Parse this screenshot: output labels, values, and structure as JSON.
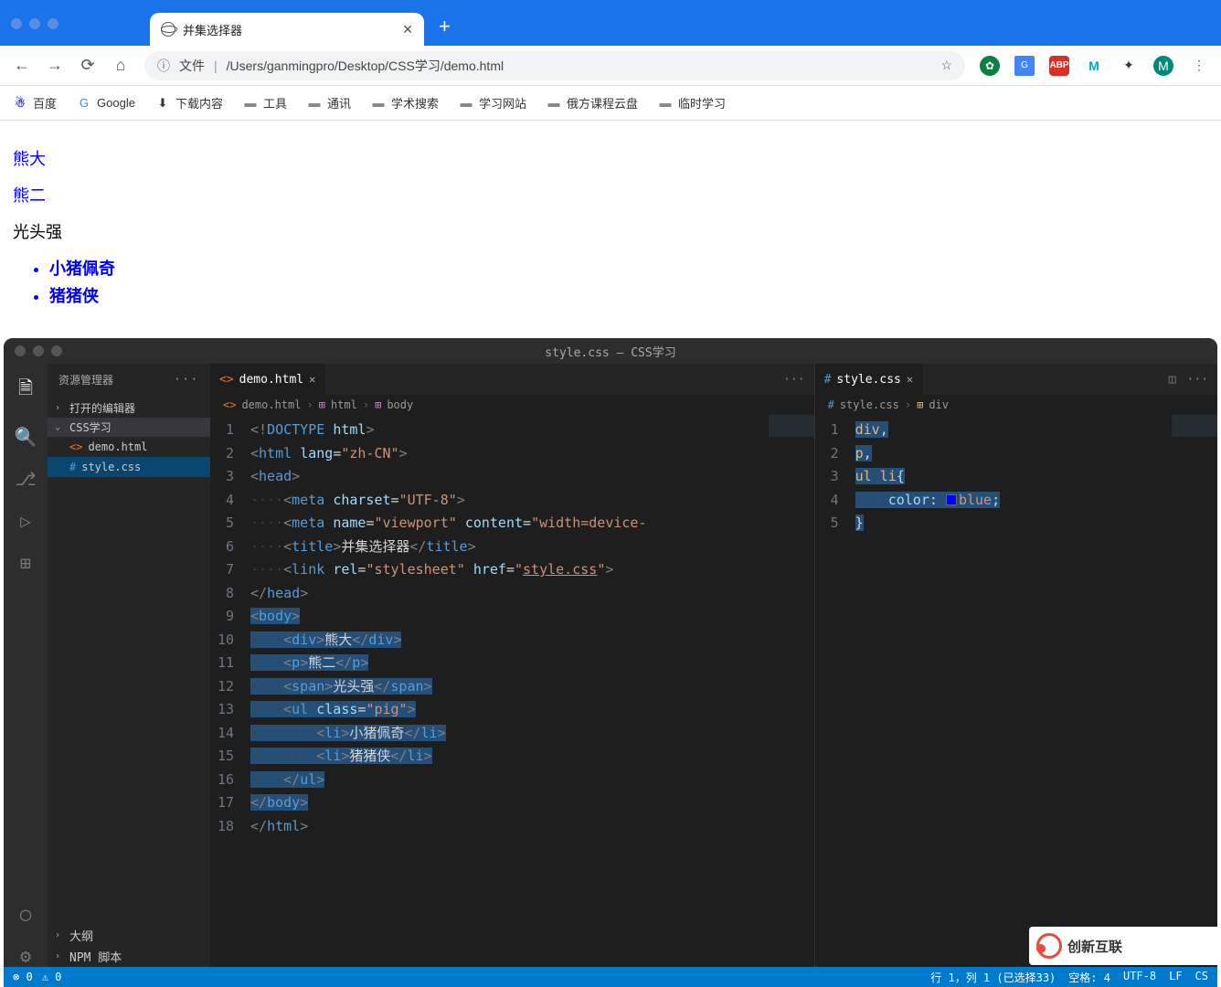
{
  "browser": {
    "tab_title": "并集选择器",
    "address": {
      "label": "文件",
      "path": "/Users/ganmingpro/Desktop/CSS学习/demo.html"
    },
    "bookmarks": [
      "百度",
      "Google",
      "下载内容",
      "工具",
      "通讯",
      "学术搜索",
      "学习网站",
      "俄方课程云盘",
      "临时学习"
    ]
  },
  "page": {
    "div": "熊大",
    "p": "熊二",
    "span": "光头强",
    "li1": "小猪佩奇",
    "li2": "猪猪侠"
  },
  "vscode": {
    "title": "style.css — CSS学习",
    "explorer": {
      "title": "资源管理器",
      "open_editors": "打开的编辑器",
      "folder": "CSS学习",
      "files": [
        "demo.html",
        "style.css"
      ],
      "outline": "大纲",
      "npm": "NPM 脚本"
    },
    "left_editor": {
      "tab": "demo.html",
      "breadcrumb": [
        "demo.html",
        "html",
        "body"
      ],
      "lines": [
        {
          "n": 1,
          "h": "<span class='tk-gray'>&lt;!</span><span class='tk-doctype'>DOCTYPE</span> <span class='tk-attr'>html</span><span class='tk-gray'>&gt;</span>"
        },
        {
          "n": 2,
          "h": "<span class='tk-gray'>&lt;</span><span class='tk-tag'>html</span> <span class='tk-attr'>lang</span><span class='tk-txt'>=</span><span class='tk-str'>\"zh-CN\"</span><span class='tk-gray'>&gt;</span>"
        },
        {
          "n": 3,
          "h": "<span class='tk-gray'>&lt;</span><span class='tk-tag'>head</span><span class='tk-gray'>&gt;</span>"
        },
        {
          "n": 4,
          "h": "<span class='dots'>····</span><span class='tk-gray'>&lt;</span><span class='tk-tag'>meta</span> <span class='tk-attr'>charset</span><span class='tk-txt'>=</span><span class='tk-str'>\"UTF-8\"</span><span class='tk-gray'>&gt;</span>"
        },
        {
          "n": 5,
          "h": "<span class='dots'>····</span><span class='tk-gray'>&lt;</span><span class='tk-tag'>meta</span> <span class='tk-attr'>name</span><span class='tk-txt'>=</span><span class='tk-str'>\"viewport\"</span> <span class='tk-attr'>content</span><span class='tk-txt'>=</span><span class='tk-str'>\"width=device-</span>"
        },
        {
          "n": 6,
          "h": "<span class='dots'>····</span><span class='tk-gray'>&lt;</span><span class='tk-tag'>title</span><span class='tk-gray'>&gt;</span><span class='tk-txt'>并集选择器</span><span class='tk-gray'>&lt;/</span><span class='tk-tag'>title</span><span class='tk-gray'>&gt;</span>"
        },
        {
          "n": 7,
          "h": "<span class='dots'>····</span><span class='tk-gray'>&lt;</span><span class='tk-tag'>link</span> <span class='tk-attr'>rel</span><span class='tk-txt'>=</span><span class='tk-str'>\"stylesheet\"</span> <span class='tk-attr'>href</span><span class='tk-txt'>=</span><span class='tk-str'>\"</span><span class='tk-link'>style.css</span><span class='tk-str'>\"</span><span class='tk-gray'>&gt;</span>"
        },
        {
          "n": 8,
          "h": "<span class='tk-gray'>&lt;/</span><span class='tk-tag'>head</span><span class='tk-gray'>&gt;</span>"
        },
        {
          "n": 9,
          "h": "<span class='hl'><span class='tk-gray'>&lt;</span><span class='tk-tag'>body</span><span class='tk-gray'>&gt;</span></span>"
        },
        {
          "n": 10,
          "h": "<span class='hl'><span class='dots'>····</span><span class='tk-gray'>&lt;</span><span class='tk-tag'>div</span><span class='tk-gray'>&gt;</span><span class='tk-txt'>熊大</span><span class='tk-gray'>&lt;/</span><span class='tk-tag'>div</span><span class='tk-gray'>&gt;</span></span>"
        },
        {
          "n": 11,
          "h": "<span class='hl'><span class='dots'>····</span><span class='tk-gray'>&lt;</span><span class='tk-tag'>p</span><span class='tk-gray'>&gt;</span><span class='tk-txt'>熊二</span><span class='tk-gray'>&lt;/</span><span class='tk-tag'>p</span><span class='tk-gray'>&gt;</span></span>"
        },
        {
          "n": 12,
          "h": "<span class='hl'><span class='dots'>····</span><span class='tk-gray'>&lt;</span><span class='tk-tag'>span</span><span class='tk-gray'>&gt;</span><span class='tk-txt'>光头强</span><span class='tk-gray'>&lt;/</span><span class='tk-tag'>span</span><span class='tk-gray'>&gt;</span></span>"
        },
        {
          "n": 13,
          "h": "<span class='hl'><span class='dots'>····</span><span class='tk-gray'>&lt;</span><span class='tk-tag'>ul</span> <span class='tk-attr'>class</span><span class='tk-txt'>=</span><span class='tk-str'>\"pig\"</span><span class='tk-gray'>&gt;</span></span>"
        },
        {
          "n": 14,
          "h": "<span class='hl'><span class='dots'>········</span><span class='tk-gray'>&lt;</span><span class='tk-tag'>li</span><span class='tk-gray'>&gt;</span><span class='tk-txt'>小猪佩奇</span><span class='tk-gray'>&lt;/</span><span class='tk-tag'>li</span><span class='tk-gray'>&gt;</span></span>"
        },
        {
          "n": 15,
          "h": "<span class='hl'><span class='dots'>········</span><span class='tk-gray'>&lt;</span><span class='tk-tag'>li</span><span class='tk-gray'>&gt;</span><span class='tk-txt'>猪猪侠</span><span class='tk-gray'>&lt;/</span><span class='tk-tag'>li</span><span class='tk-gray'>&gt;</span></span>"
        },
        {
          "n": 16,
          "h": "<span class='hl'><span class='dots'>····</span><span class='tk-gray'>&lt;/</span><span class='tk-tag'>ul</span><span class='tk-gray'>&gt;</span></span>"
        },
        {
          "n": 17,
          "h": "<span class='hl'><span class='tk-gray'>&lt;/</span><span class='tk-tag'>body</span><span class='tk-gray'>&gt;</span></span>"
        },
        {
          "n": 18,
          "h": "<span class='tk-gray'>&lt;/</span><span class='tk-tag'>html</span><span class='tk-gray'>&gt;</span>"
        }
      ]
    },
    "right_editor": {
      "tab": "style.css",
      "breadcrumb": [
        "style.css",
        "div"
      ],
      "lines": [
        {
          "n": 1,
          "h": "<span class='hl'><span class='tk-sel'>div</span><span class='tk-txt'>,</span></span>"
        },
        {
          "n": 2,
          "h": "<span class='hl'><span class='tk-sel'>p</span><span class='tk-txt'>,</span></span>"
        },
        {
          "n": 3,
          "h": "<span class='hl'><span class='tk-sel'>ul</span> <span class='tk-sel'>li</span><span class='tk-txt'>{</span></span>"
        },
        {
          "n": 4,
          "h": "<span class='hl'><span class='dots'>····</span><span class='tk-prop'>color</span><span class='tk-txt'>: </span><span class='color-swatch'></span><span class='tk-val'>blue</span><span class='tk-txt'>;</span></span>"
        },
        {
          "n": 5,
          "h": "<span class='hl'><span class='tk-txt'>}</span></span>"
        }
      ]
    },
    "status": {
      "errors": "⊗ 0",
      "warnings": "⚠ 0",
      "cursor": "行 1，列 1 (已选择33)",
      "spaces": "空格: 4",
      "encoding": "UTF-8",
      "eol": "LF",
      "lang": "CS"
    }
  },
  "watermark": "创新互联"
}
